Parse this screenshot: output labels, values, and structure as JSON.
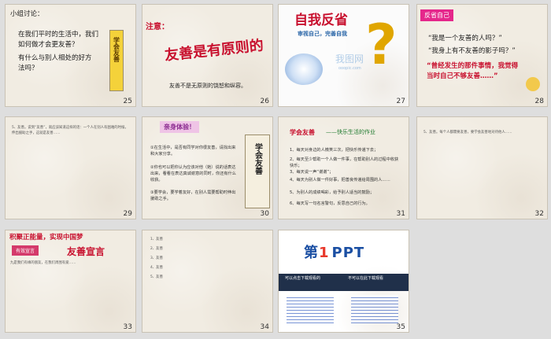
{
  "slides": [
    {
      "number": "25",
      "lines": [
        "小组讨论：",
        "在我们平时的生活中，我们如何做才会更友善？",
        "有什么与别人相处的好方法吗？"
      ],
      "scroll_text": "学会友善"
    },
    {
      "number": "26",
      "badge": "注意：",
      "title": "友善是有原则的",
      "subtitle": "友善不是无原则的饶恕和纵容。"
    },
    {
      "number": "27",
      "title": "自我反省",
      "subtitle": "审视自己，完善自我",
      "watermark": "我图网",
      "watermark_sub": "ooopic.com"
    },
    {
      "number": "28",
      "heading": "反省自己",
      "lines": [
        "“我是一个友善的人吗？”",
        "“我身上有不友善的影子吗？”"
      ],
      "red": "“曾经发生的那件事情，我觉得当时自己不够友善……”"
    },
    {
      "number": "29",
      "paragraph": "5、友善。说到“友善”，就应该知道这样的话：一个人在别人有困难的时候，伸出援助之手，这就是友善……"
    },
    {
      "number": "30",
      "title": "亲身体验！",
      "lines": [
        "①在生活中，是否有同学对你很友善，请找出来和大家分享。",
        "②你也可以把你认为应该对他（她）说的话表达出来，看看在表达真诚谢意的同时，你还有什么收获。",
        "③要学会，要学着友好，在别人需要帮助时伸出援助之手。"
      ],
      "scroll_text": "学会友善"
    },
    {
      "number": "31",
      "title": "学会友善",
      "title2": "——快乐生活的作业",
      "items": [
        "1、每天对身边的人微笑三次，把快乐传递下去；",
        "2、每天至少帮助一个人做一件事，在帮助别人的过程中收获快乐；",
        "3、每天说一声“谢谢”；",
        "4、每天为别人做一件好事，把善良传递给周围的人……",
        "5、为别人的成绩喝彩，给予别人适当的鼓励；",
        "6、每天写一句名言警句，反思自己的行为。"
      ]
    },
    {
      "number": "32",
      "paragraph": "5、友善。每个人都需要友善，要学会友善地对待他人……"
    },
    {
      "number": "33",
      "heading": "积聚正能量，实现中国梦",
      "badge": "有效宣言",
      "title": "友善宣言",
      "lines": [
        "九是我们有缘的朋友，在我们周围有爱……"
      ]
    },
    {
      "number": "34",
      "lines": [
        "1、友善",
        "2、友善",
        "3、友善",
        "4、友善",
        "5、友善"
      ]
    },
    {
      "number": "35",
      "logo_part1": "第",
      "logo_part2": "1",
      "logo_part3": "PPT",
      "link1": "可以点击下载观看的",
      "link2": "不可以在此下载观看"
    }
  ]
}
